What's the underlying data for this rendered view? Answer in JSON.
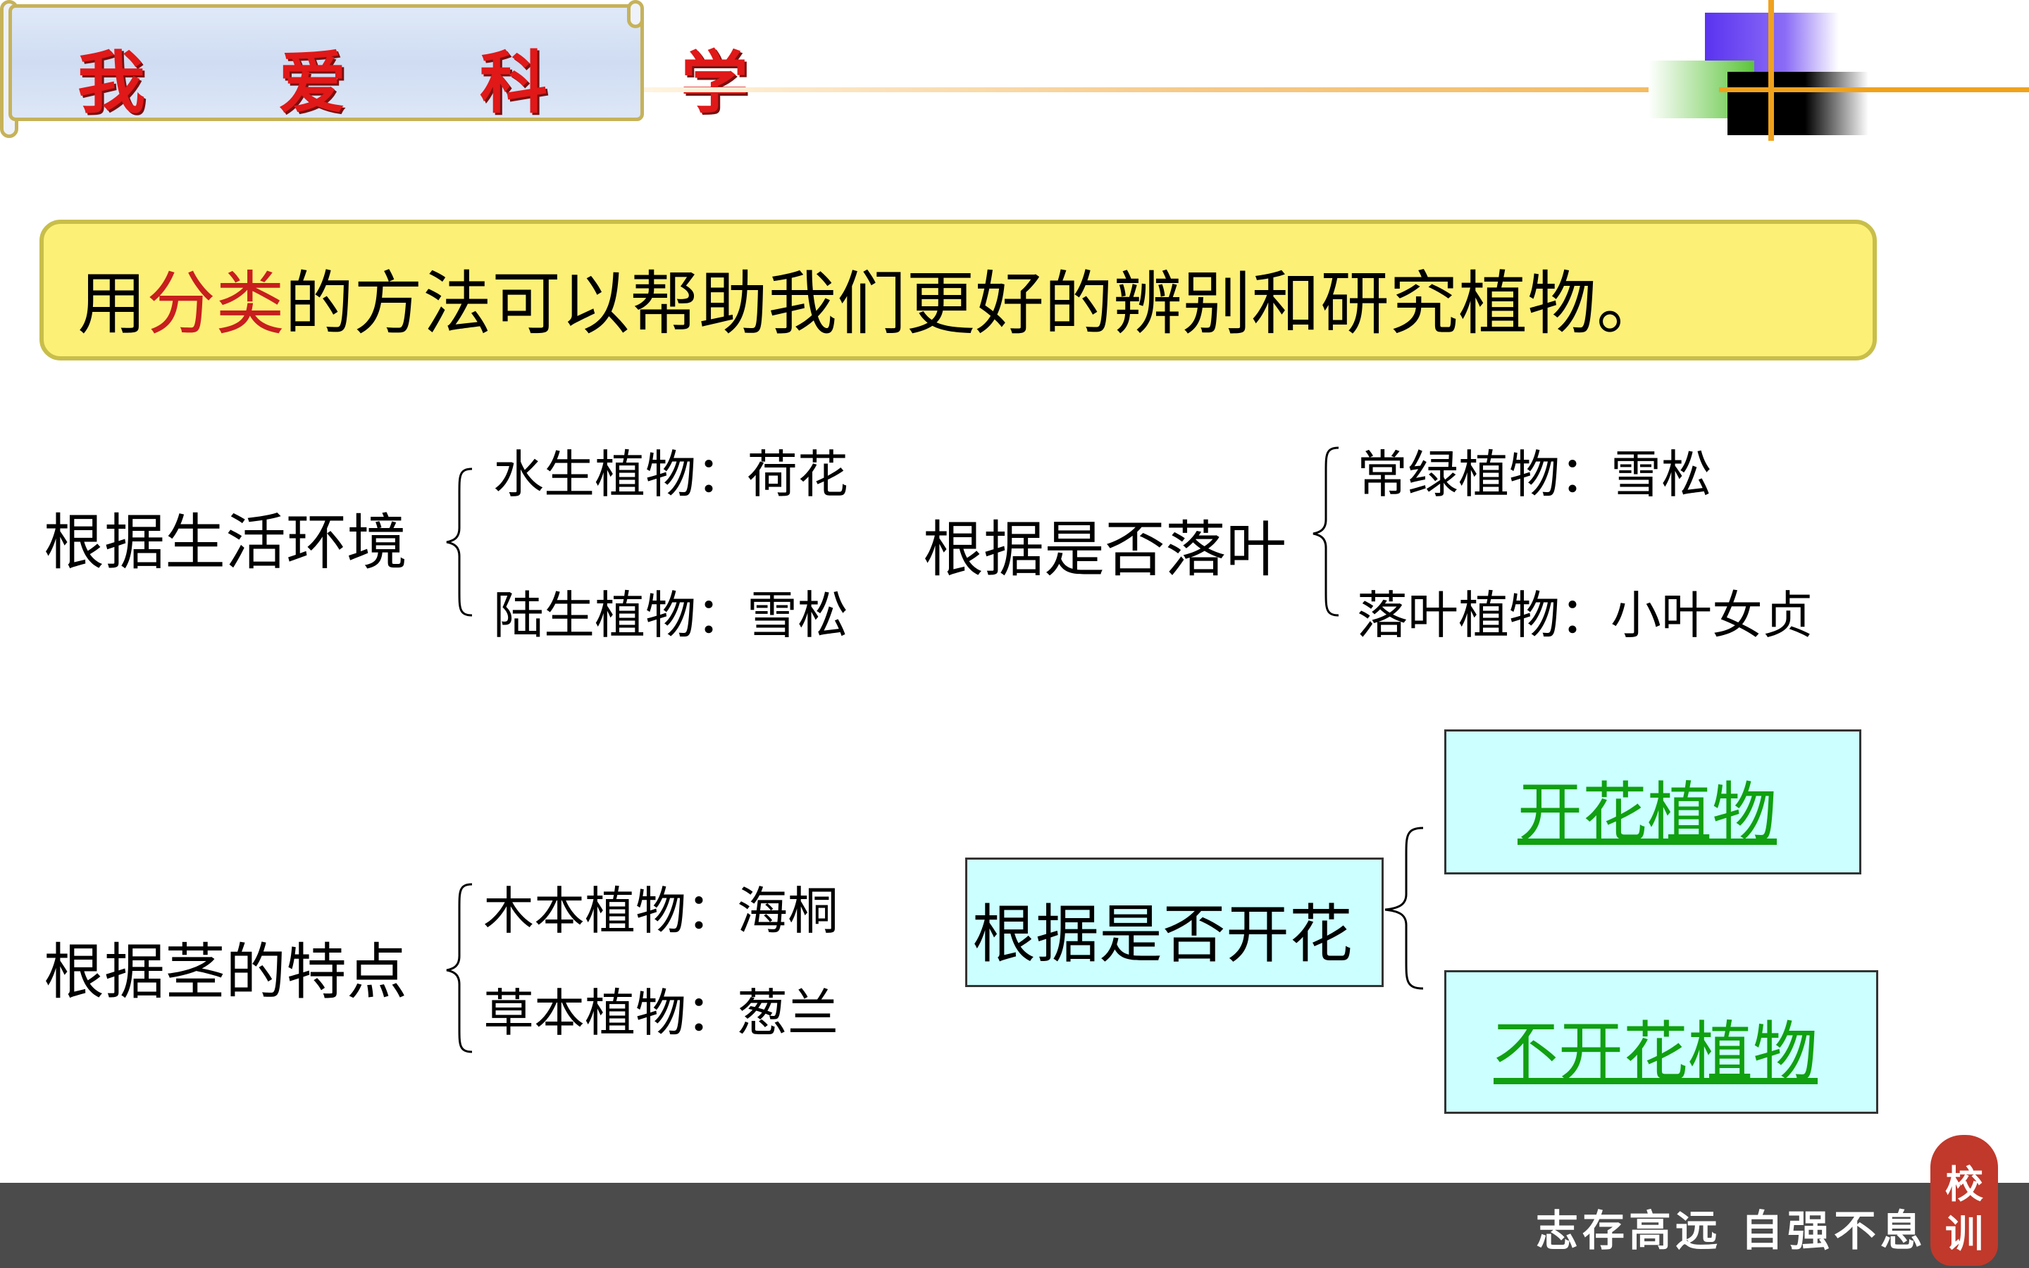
{
  "title": "我 爱 科 学",
  "banner": {
    "prefix": "用",
    "highlight": "分类",
    "suffix": "的方法可以帮助我们更好的辨别和研究植物。"
  },
  "groups": {
    "environment": {
      "label": "根据生活环境",
      "items": [
        "水生植物：荷花",
        "陆生植物：雪松"
      ]
    },
    "leaf_fall": {
      "label": "根据是否落叶",
      "items": [
        "常绿植物：雪松",
        "落叶植物：小叶女贞"
      ]
    },
    "stem": {
      "label": "根据茎的特点",
      "items": [
        "木本植物：海桐",
        "草本植物：葱兰"
      ]
    },
    "flowering": {
      "label": "根据是否开花",
      "items": [
        "开花植物",
        "不开花植物"
      ]
    }
  },
  "footer": {
    "motto": "志存高远 自强不息",
    "seal": "校训"
  },
  "colors": {
    "title_red": "#e01818",
    "banner_yellow": "#fdf077",
    "highlight_red": "#c81e1e",
    "box_cyan": "#ccffff",
    "link_green": "#10a010",
    "footer_gray": "#4b4b4b"
  }
}
